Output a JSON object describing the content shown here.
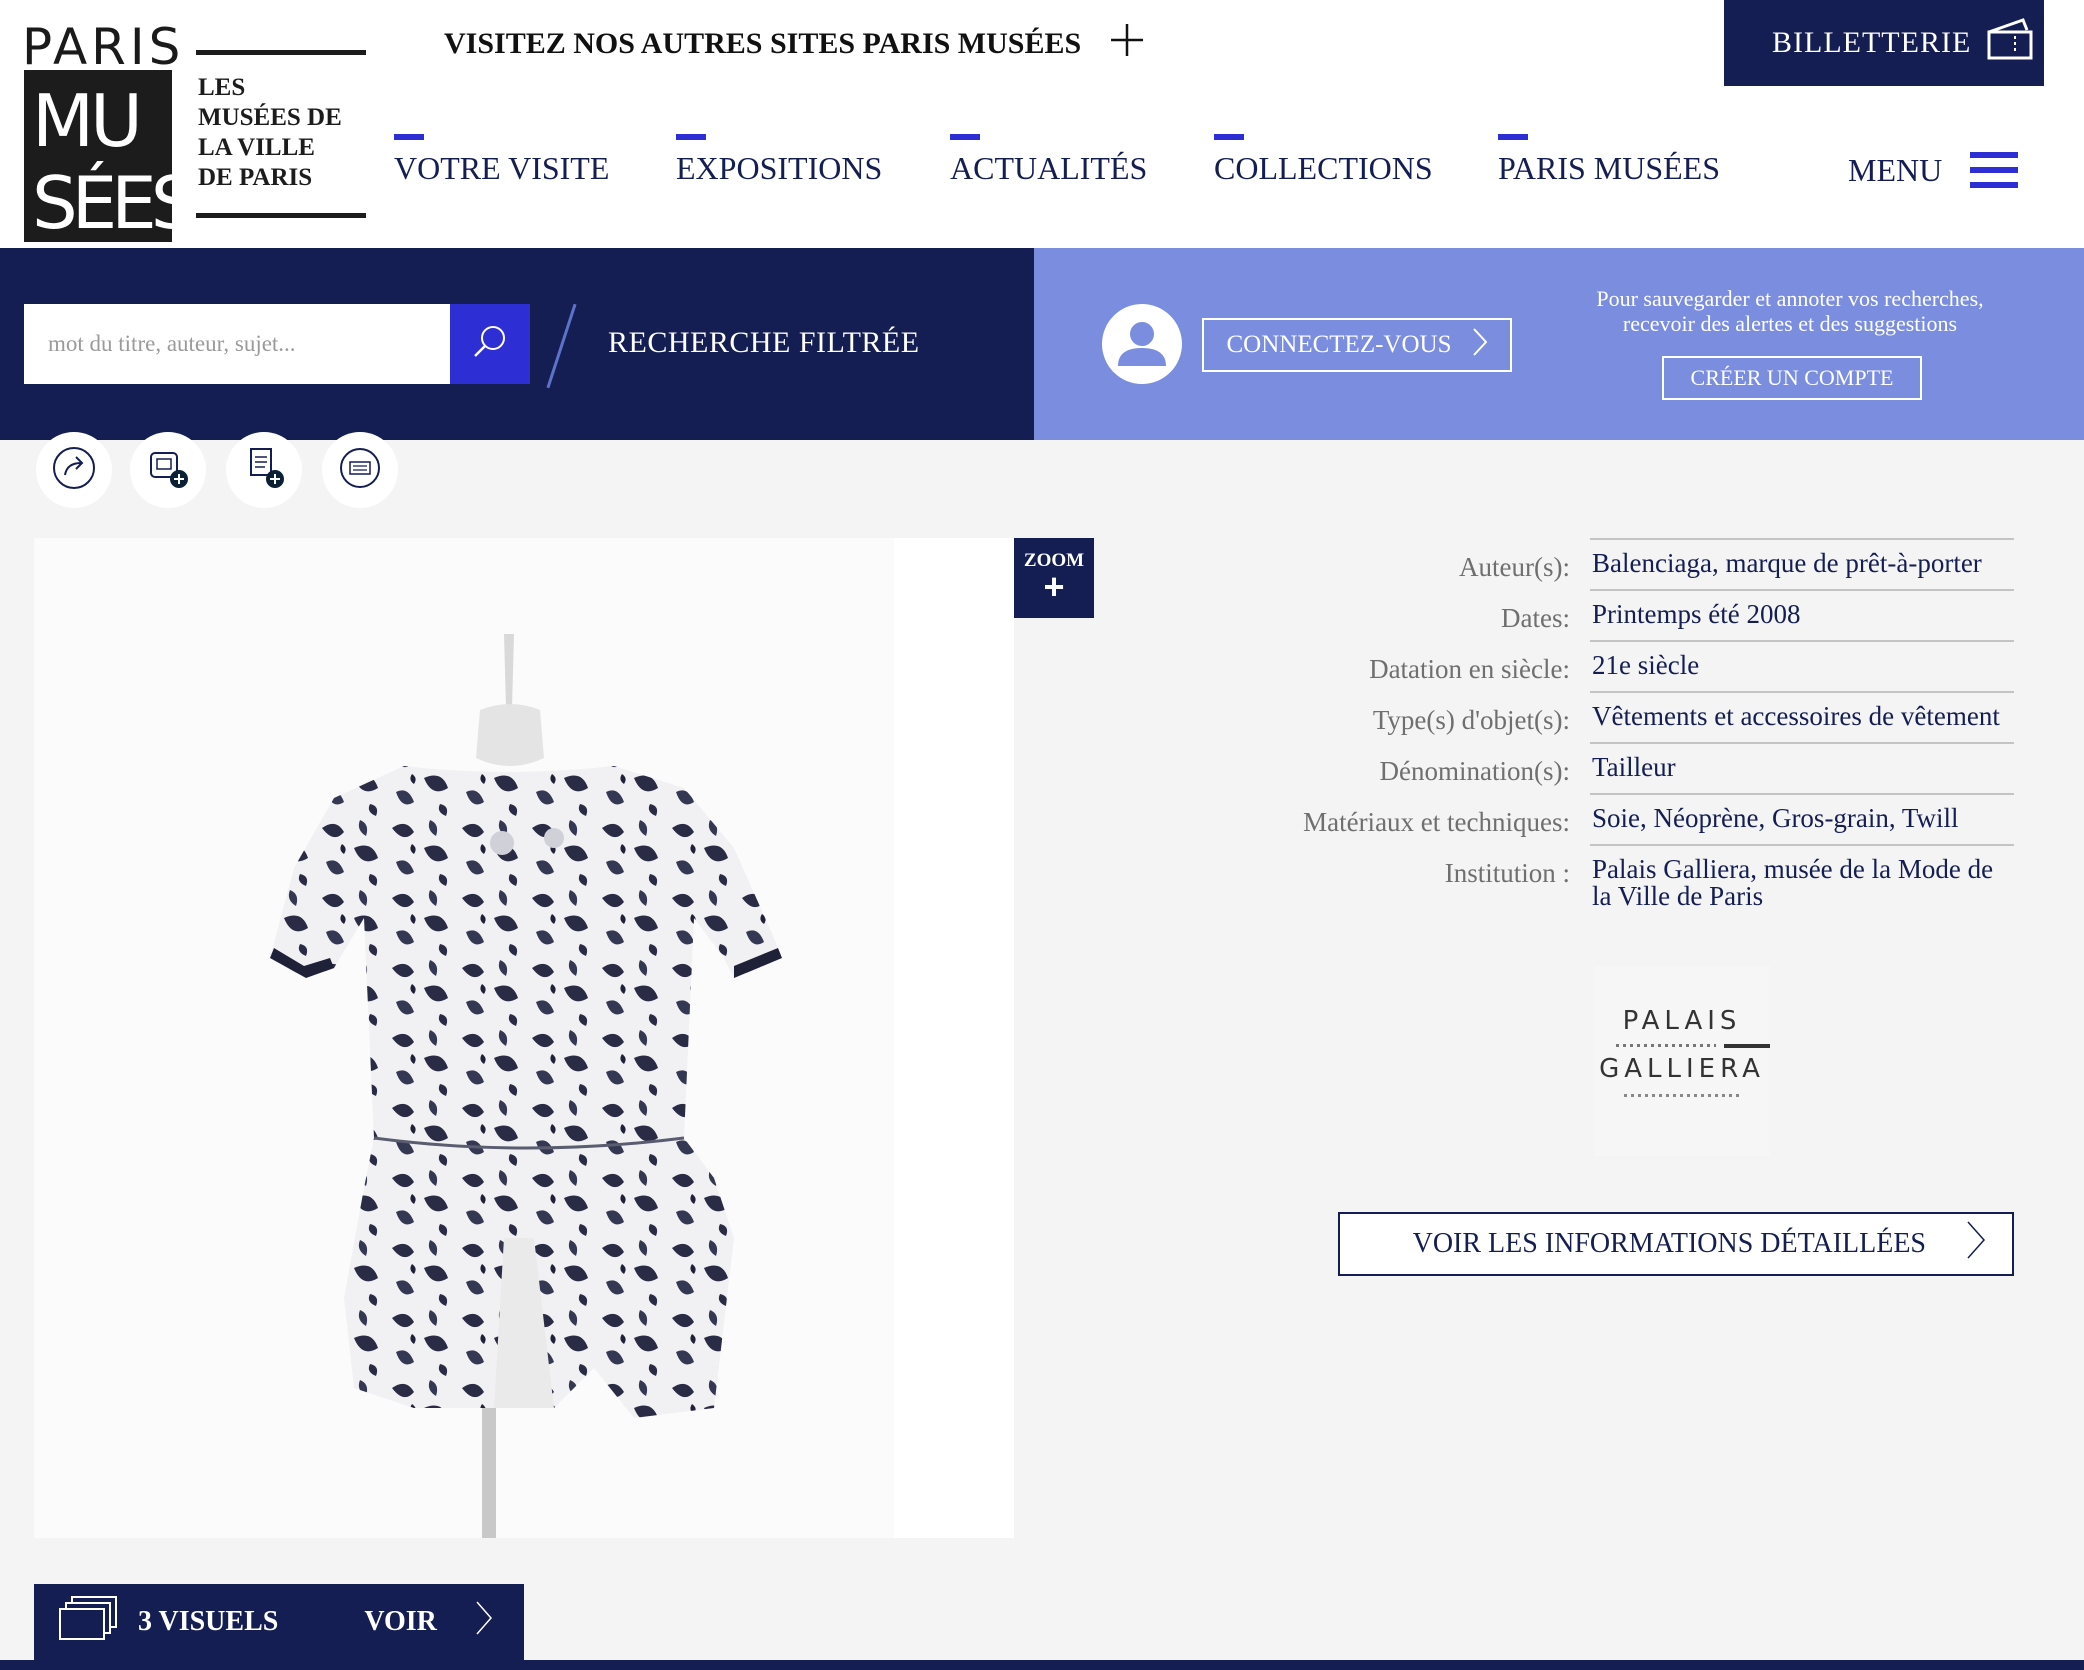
{
  "header": {
    "logo": {
      "paris": "PARIS",
      "musees": "MUSÉES",
      "subtitle": [
        "LES",
        "MUSÉES DE",
        "LA VILLE",
        "DE PARIS"
      ]
    },
    "other_sites_label": "VISITEZ NOS AUTRES SITES PARIS MUSÉES",
    "billetterie_label": "BILLETTERIE",
    "nav": [
      {
        "label": "VOTRE VISITE"
      },
      {
        "label": "EXPOSITIONS"
      },
      {
        "label": "ACTUALITÉS"
      },
      {
        "label": "COLLECTIONS"
      },
      {
        "label": "PARIS MUSÉES"
      }
    ],
    "menu_label": "MENU",
    "accent_color": "#2d2ed4",
    "navy_color": "#141e52"
  },
  "search": {
    "placeholder": "mot du titre, auteur, sujet...",
    "filtered_label": "RECHERCHE FILTRÉE"
  },
  "account": {
    "connect_label": "CONNECTEZ-VOUS",
    "save_text_line1": "Pour sauvegarder et annoter vos recherches,",
    "save_text_line2": "recevoir des alertes et des suggestions",
    "create_label": "CRÉER UN COMPTE",
    "panel_color": "#7a8ddf"
  },
  "tools": [
    "share-icon",
    "add-to-album-icon",
    "add-to-list-icon",
    "print-icon"
  ],
  "image": {
    "zoom_label": "ZOOM",
    "zoom_plus": "+"
  },
  "metadata": {
    "rows": [
      {
        "label": "Auteur(s):",
        "value_link": "Balenciaga",
        "value_rest": ", marque de prêt-à-porter"
      },
      {
        "label": "Dates:",
        "value": "Printemps été 2008"
      },
      {
        "label": "Datation en siècle:",
        "value": "21e siècle"
      },
      {
        "label": "Type(s) d'objet(s):",
        "value": "Vêtements et accessoires de vêtement"
      },
      {
        "label": "Dénomination(s):",
        "value": "Tailleur"
      },
      {
        "label": "Matériaux et techniques:",
        "value": "Soie, Néoprène, Gros-grain, Twill"
      },
      {
        "label": "Institution :",
        "value": "Palais Galliera, musée de la Mode de la Ville de Paris"
      }
    ],
    "institution_logo": {
      "line1": "PALAIS",
      "line2": "GALLIERA"
    }
  },
  "details_button_label": "VOIR LES INFORMATIONS DÉTAILLÉES",
  "visuels": {
    "count_label": "3 VISUELS",
    "voir_label": "VOIR"
  }
}
